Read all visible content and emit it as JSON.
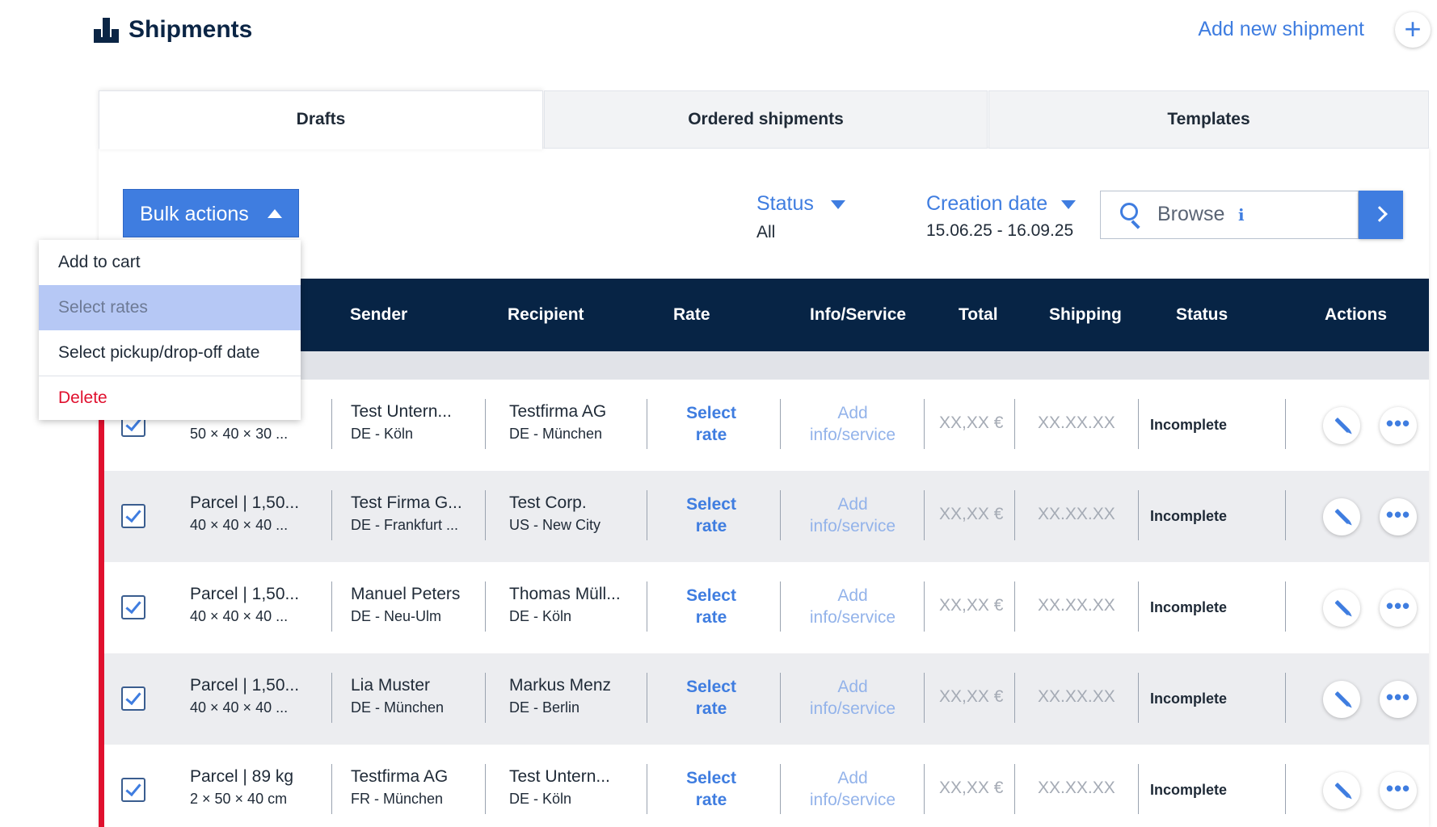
{
  "header": {
    "title": "Shipments",
    "add_link": "Add new shipment",
    "add_icon": "+"
  },
  "tabs": [
    {
      "label": "Drafts",
      "active": true
    },
    {
      "label": "Ordered shipments",
      "active": false
    },
    {
      "label": "Templates",
      "active": false
    }
  ],
  "toolbar": {
    "bulk_label": "Bulk actions",
    "status_label": "Status",
    "status_value": "All",
    "date_label": "Creation date",
    "date_value": "15.06.25 - 16.09.25",
    "search_placeholder": "Browse",
    "info_glyph": "i"
  },
  "bulk_menu": [
    {
      "label": "Add to cart",
      "state": "normal"
    },
    {
      "label": "Select rates",
      "state": "disabled"
    },
    {
      "label": "Select pickup/drop-off date",
      "state": "normal"
    },
    {
      "label": "Delete",
      "state": "danger"
    }
  ],
  "columns": [
    "Sender",
    "Recipient",
    "Rate",
    "Info/Service",
    "Total",
    "Shipping",
    "Status",
    "Actions"
  ],
  "rows": [
    {
      "parcel": "",
      "dims": "50 × 40 × 30 ...",
      "sender": "Test Untern...",
      "sender_loc": "DE - Köln",
      "recipient": "Testfirma AG",
      "recipient_loc": "DE - München",
      "rate_link": "Select\nrate",
      "info_link": "Add\ninfo/service",
      "total": "XX,XX €",
      "shipping": "XX.XX.XX",
      "status": "Incomplete",
      "checked": true
    },
    {
      "parcel": "Parcel | 1,50...",
      "dims": "40 × 40 × 40 ...",
      "sender": "Test Firma G...",
      "sender_loc": "DE - Frankfurt ...",
      "recipient": "Test Corp.",
      "recipient_loc": "US - New City",
      "rate_link": "Select\nrate",
      "info_link": "Add\ninfo/service",
      "total": "XX,XX €",
      "shipping": "XX.XX.XX",
      "status": "Incomplete",
      "checked": true
    },
    {
      "parcel": "Parcel | 1,50...",
      "dims": "40 × 40 × 40 ...",
      "sender": "Manuel Peters",
      "sender_loc": "DE - Neu-Ulm",
      "recipient": "Thomas Müll...",
      "recipient_loc": "DE - Köln",
      "rate_link": "Select\nrate",
      "info_link": "Add\ninfo/service",
      "total": "XX,XX €",
      "shipping": "XX.XX.XX",
      "status": "Incomplete",
      "checked": true
    },
    {
      "parcel": "Parcel | 1,50...",
      "dims": "40 × 40 × 40 ...",
      "sender": "Lia Muster",
      "sender_loc": "DE - München",
      "recipient": "Markus Menz",
      "recipient_loc": "DE - Berlin",
      "rate_link": "Select\nrate",
      "info_link": "Add\ninfo/service",
      "total": "XX,XX €",
      "shipping": "XX.XX.XX",
      "status": "Incomplete",
      "checked": true
    },
    {
      "parcel": "Parcel | 89 kg",
      "dims": "2 × 50 × 40 cm",
      "sender": "Testfirma AG",
      "sender_loc": "FR - München",
      "recipient": "Test Untern...",
      "recipient_loc": "DE - Köln",
      "rate_link": "Select\nrate",
      "info_link": "Add\ninfo/service",
      "total": "XX,XX €",
      "shipping": "XX.XX.XX",
      "status": "Incomplete",
      "checked": true
    }
  ],
  "row_actions": {
    "edit_icon": "pencil-icon",
    "more_glyph": "•••"
  },
  "colors": {
    "accent": "#3f7de0",
    "navy": "#072445",
    "danger": "#e0102e"
  }
}
